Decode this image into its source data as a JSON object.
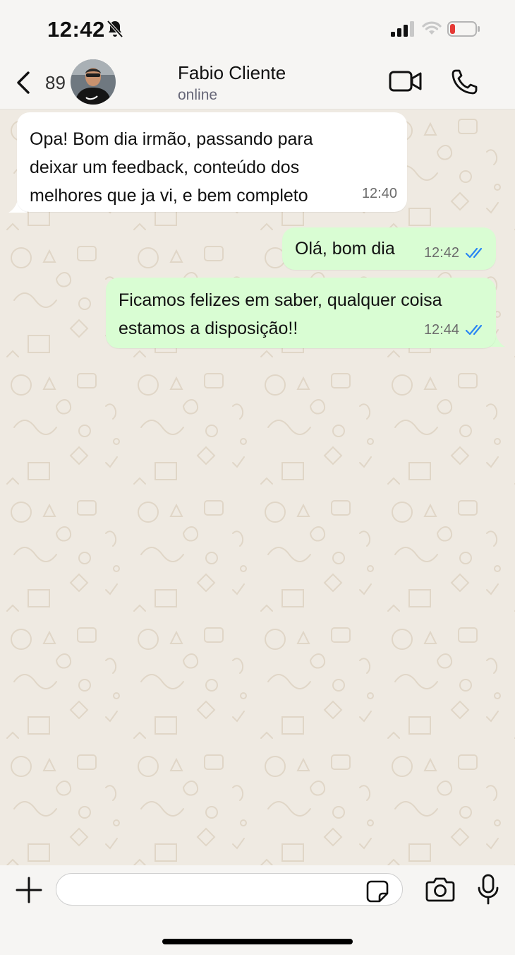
{
  "status_bar": {
    "time": "12:42",
    "icons": [
      "bell-slash-icon",
      "signal-icon",
      "wifi-icon",
      "battery-low-icon"
    ]
  },
  "header": {
    "unread_count": "89",
    "contact_name": "Fabio Cliente",
    "contact_status": "online",
    "icons": [
      "chevron-left-icon",
      "video-camera-icon",
      "phone-icon"
    ]
  },
  "messages": [
    {
      "direction": "incoming",
      "text": "Opa! Bom dia irmão, passando para\ndeixar um feedback, conteúdo dos\nmelhores que ja vi, e bem completo",
      "time": "12:40"
    },
    {
      "direction": "outgoing",
      "text": "Olá, bom dia",
      "time": "12:42",
      "status": "read"
    },
    {
      "direction": "outgoing",
      "text": "Ficamos felizes em saber, qualquer coisa\nestamos a disposição!!",
      "time": "12:44",
      "status": "read"
    }
  ],
  "input_bar": {
    "placeholder": "",
    "icons": [
      "plus-icon",
      "sticker-icon",
      "camera-icon",
      "microphone-icon"
    ]
  },
  "colors": {
    "outgoing_bubble": "#d9fdd3",
    "incoming_bubble": "#ffffff",
    "read_ticks": "#2a86f3",
    "wallpaper": "#efeae2",
    "battery_low": "#e53935"
  }
}
